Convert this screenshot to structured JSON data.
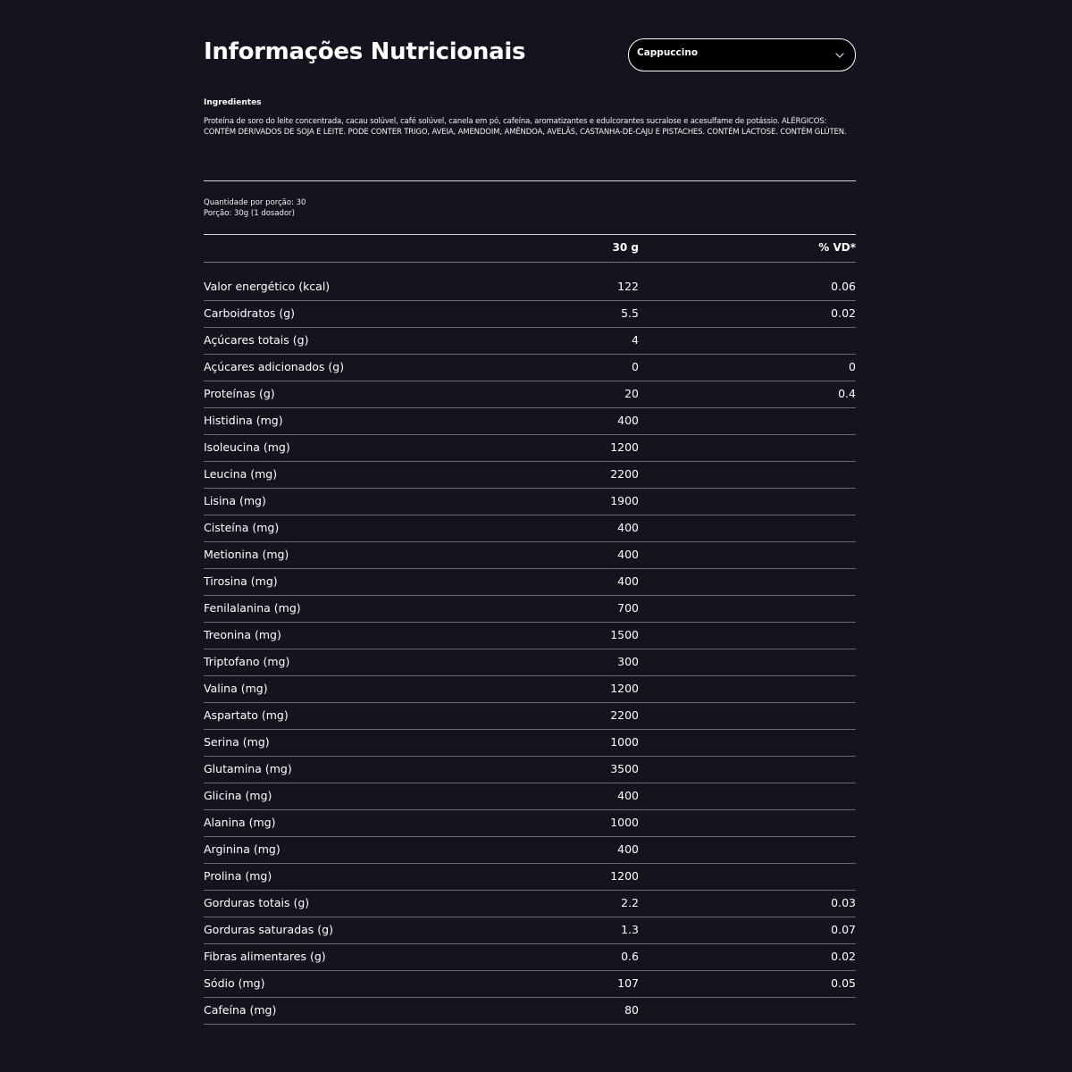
{
  "header": {
    "title": "Informações Nutricionais"
  },
  "flavor_select": {
    "selected": "Cappuccino"
  },
  "ingredients": {
    "title": "Ingredientes",
    "text": "Proteína de soro do leite concentrada, cacau solúvel, café solúvel, canela em pó, cafeína, aromatizantes e edulcorantes sucralose e acesulfame de potássio. ALÉRGICOS: CONTÉM DERIVADOS DE SOJA E LEITE. PODE CONTER TRIGO, AVEIA, AMENDOIM, AMÊNDOA, AVELÃS, CASTANHA-DE-CAJU E PISTACHES. CONTÉM LACTOSE. CONTÉM GLÚTEN."
  },
  "serving": {
    "quantity": "Quantidade por porção: 30",
    "portion": "Porção: 30g (1 dosador)"
  },
  "table": {
    "col_amount": "30 g",
    "col_vd": "% VD*",
    "rows": [
      {
        "name": "Valor energético (kcal)",
        "amount": "122",
        "vd": "0.06"
      },
      {
        "name": "Carboidratos (g)",
        "amount": "5.5",
        "vd": "0.02"
      },
      {
        "name": "Açúcares totais (g)",
        "amount": "4",
        "vd": ""
      },
      {
        "name": "Açúcares adicionados (g)",
        "amount": "0",
        "vd": "0"
      },
      {
        "name": "Proteínas (g)",
        "amount": "20",
        "vd": "0.4"
      },
      {
        "name": "Histidina (mg)",
        "amount": "400",
        "vd": ""
      },
      {
        "name": "Isoleucina (mg)",
        "amount": "1200",
        "vd": ""
      },
      {
        "name": "Leucina (mg)",
        "amount": "2200",
        "vd": ""
      },
      {
        "name": "Lisina (mg)",
        "amount": "1900",
        "vd": ""
      },
      {
        "name": "Cisteína (mg)",
        "amount": "400",
        "vd": ""
      },
      {
        "name": "Metionina (mg)",
        "amount": "400",
        "vd": ""
      },
      {
        "name": "Tirosina (mg)",
        "amount": "400",
        "vd": ""
      },
      {
        "name": "Fenilalanina (mg)",
        "amount": "700",
        "vd": ""
      },
      {
        "name": "Treonina (mg)",
        "amount": "1500",
        "vd": ""
      },
      {
        "name": "Triptofano (mg)",
        "amount": "300",
        "vd": ""
      },
      {
        "name": "Valina (mg)",
        "amount": "1200",
        "vd": ""
      },
      {
        "name": "Aspartato (mg)",
        "amount": "2200",
        "vd": ""
      },
      {
        "name": "Serina (mg)",
        "amount": "1000",
        "vd": ""
      },
      {
        "name": "Glutamina (mg)",
        "amount": "3500",
        "vd": ""
      },
      {
        "name": "Glicina (mg)",
        "amount": "400",
        "vd": ""
      },
      {
        "name": "Alanina (mg)",
        "amount": "1000",
        "vd": ""
      },
      {
        "name": "Arginina (mg)",
        "amount": "400",
        "vd": ""
      },
      {
        "name": "Prolina (mg)",
        "amount": "1200",
        "vd": ""
      },
      {
        "name": "Gorduras totais (g)",
        "amount": "2.2",
        "vd": "0.03"
      },
      {
        "name": "Gorduras saturadas (g)",
        "amount": "1.3",
        "vd": "0.07"
      },
      {
        "name": "Fibras alimentares (g)",
        "amount": "0.6",
        "vd": "0.02"
      },
      {
        "name": "Sódio (mg)",
        "amount": "107",
        "vd": "0.05"
      },
      {
        "name": "Cafeína (mg)",
        "amount": "80",
        "vd": ""
      }
    ]
  },
  "colors": {
    "background": "#14141f",
    "text": "#ffffff",
    "select_background": "#000000",
    "divider": "#d9d9d9"
  },
  "icons": {
    "select_chevron": "chevron-down-icon"
  }
}
